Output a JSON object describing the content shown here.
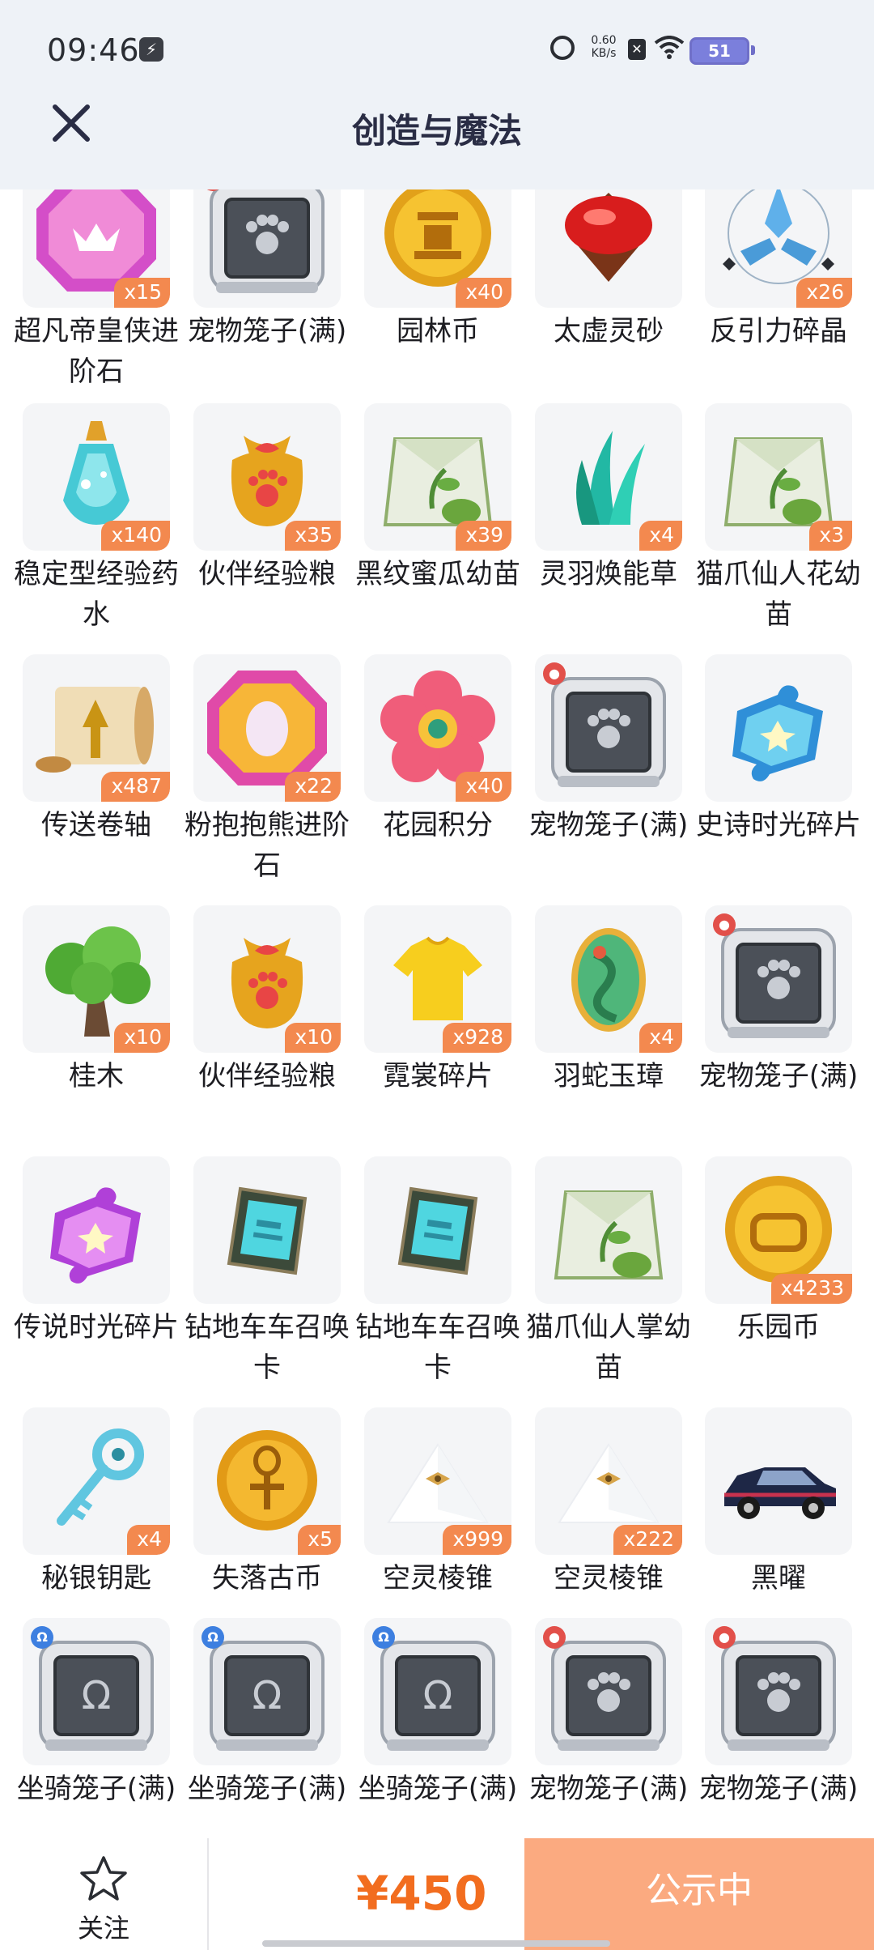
{
  "status_bar": {
    "time": "09:46",
    "net_speed_value": "0.60",
    "net_speed_unit": "KB/s",
    "battery": "51"
  },
  "header": {
    "title": "创造与魔法",
    "close_icon": "close-icon"
  },
  "items": [
    {
      "name": "超凡帝皇侠进阶石",
      "qty": "x15",
      "icon": "purple-gem-icon"
    },
    {
      "name": "宠物笼子(满)",
      "qty": "",
      "icon": "pet-cage-icon"
    },
    {
      "name": "园林币",
      "qty": "x40",
      "icon": "garden-coin-icon"
    },
    {
      "name": "太虚灵砂",
      "qty": "",
      "icon": "red-sand-icon"
    },
    {
      "name": "反引力碎晶",
      "qty": "x26",
      "icon": "crystal-shard-icon"
    },
    {
      "name": "稳定型经验药水",
      "qty": "x140",
      "icon": "potion-icon"
    },
    {
      "name": "伙伴经验粮",
      "qty": "x35",
      "icon": "food-bag-icon"
    },
    {
      "name": "黑纹蜜瓜幼苗",
      "qty": "x39",
      "icon": "seed-pack-icon"
    },
    {
      "name": "灵羽焕能草",
      "qty": "x4",
      "icon": "feather-grass-icon"
    },
    {
      "name": "猫爪仙人花幼苗",
      "qty": "x3",
      "icon": "seed-pack-icon"
    },
    {
      "name": "传送卷轴",
      "qty": "x487",
      "icon": "scroll-icon"
    },
    {
      "name": "粉抱抱熊进阶石",
      "qty": "x22",
      "icon": "pink-gem-icon"
    },
    {
      "name": "花园积分",
      "qty": "x40",
      "icon": "flower-icon"
    },
    {
      "name": "宠物笼子(满)",
      "qty": "",
      "icon": "pet-cage-icon"
    },
    {
      "name": "史诗时光碎片",
      "qty": "",
      "icon": "blue-puzzle-icon"
    },
    {
      "name": "桂木",
      "qty": "x10",
      "icon": "tree-icon"
    },
    {
      "name": "伙伴经验粮",
      "qty": "x10",
      "icon": "food-bag-icon"
    },
    {
      "name": "霓裳碎片",
      "qty": "x928",
      "icon": "shirt-icon"
    },
    {
      "name": "羽蛇玉璋",
      "qty": "x4",
      "icon": "dragon-egg-icon"
    },
    {
      "name": "宠物笼子(满)",
      "qty": "",
      "icon": "pet-cage-icon"
    },
    {
      "name": "传说时光碎片",
      "qty": "",
      "icon": "purple-puzzle-icon"
    },
    {
      "name": "钻地车车召唤卡",
      "qty": "",
      "icon": "summon-card-icon"
    },
    {
      "name": "钻地车车召唤卡",
      "qty": "",
      "icon": "summon-card-icon"
    },
    {
      "name": "猫爪仙人掌幼苗",
      "qty": "",
      "icon": "seed-pack-icon"
    },
    {
      "name": "乐园币",
      "qty": "x4233",
      "icon": "park-coin-icon"
    },
    {
      "name": "秘银钥匙",
      "qty": "x4",
      "icon": "key-icon"
    },
    {
      "name": "失落古币",
      "qty": "x5",
      "icon": "ancient-coin-icon"
    },
    {
      "name": "空灵棱锥",
      "qty": "x999",
      "icon": "pyramid-icon"
    },
    {
      "name": "空灵棱锥",
      "qty": "x222",
      "icon": "pyramid-icon"
    },
    {
      "name": "黑曜",
      "qty": "",
      "icon": "car-icon"
    },
    {
      "name": "坐骑笼子(满)",
      "qty": "",
      "icon": "mount-cage-icon"
    },
    {
      "name": "坐骑笼子(满)",
      "qty": "",
      "icon": "mount-cage-icon"
    },
    {
      "name": "坐骑笼子(满)",
      "qty": "",
      "icon": "mount-cage-icon"
    },
    {
      "name": "宠物笼子(满)",
      "qty": "",
      "icon": "pet-cage-icon"
    },
    {
      "name": "宠物笼子(满)",
      "qty": "",
      "icon": "pet-cage-icon"
    }
  ],
  "bottom_bar": {
    "favorite_label": "关注",
    "price": "¥450",
    "status_button": "公示中"
  },
  "colors": {
    "accent": "#f26d1f",
    "qty_badge": "#f3894f",
    "status_button_bg": "#fbaa80"
  }
}
